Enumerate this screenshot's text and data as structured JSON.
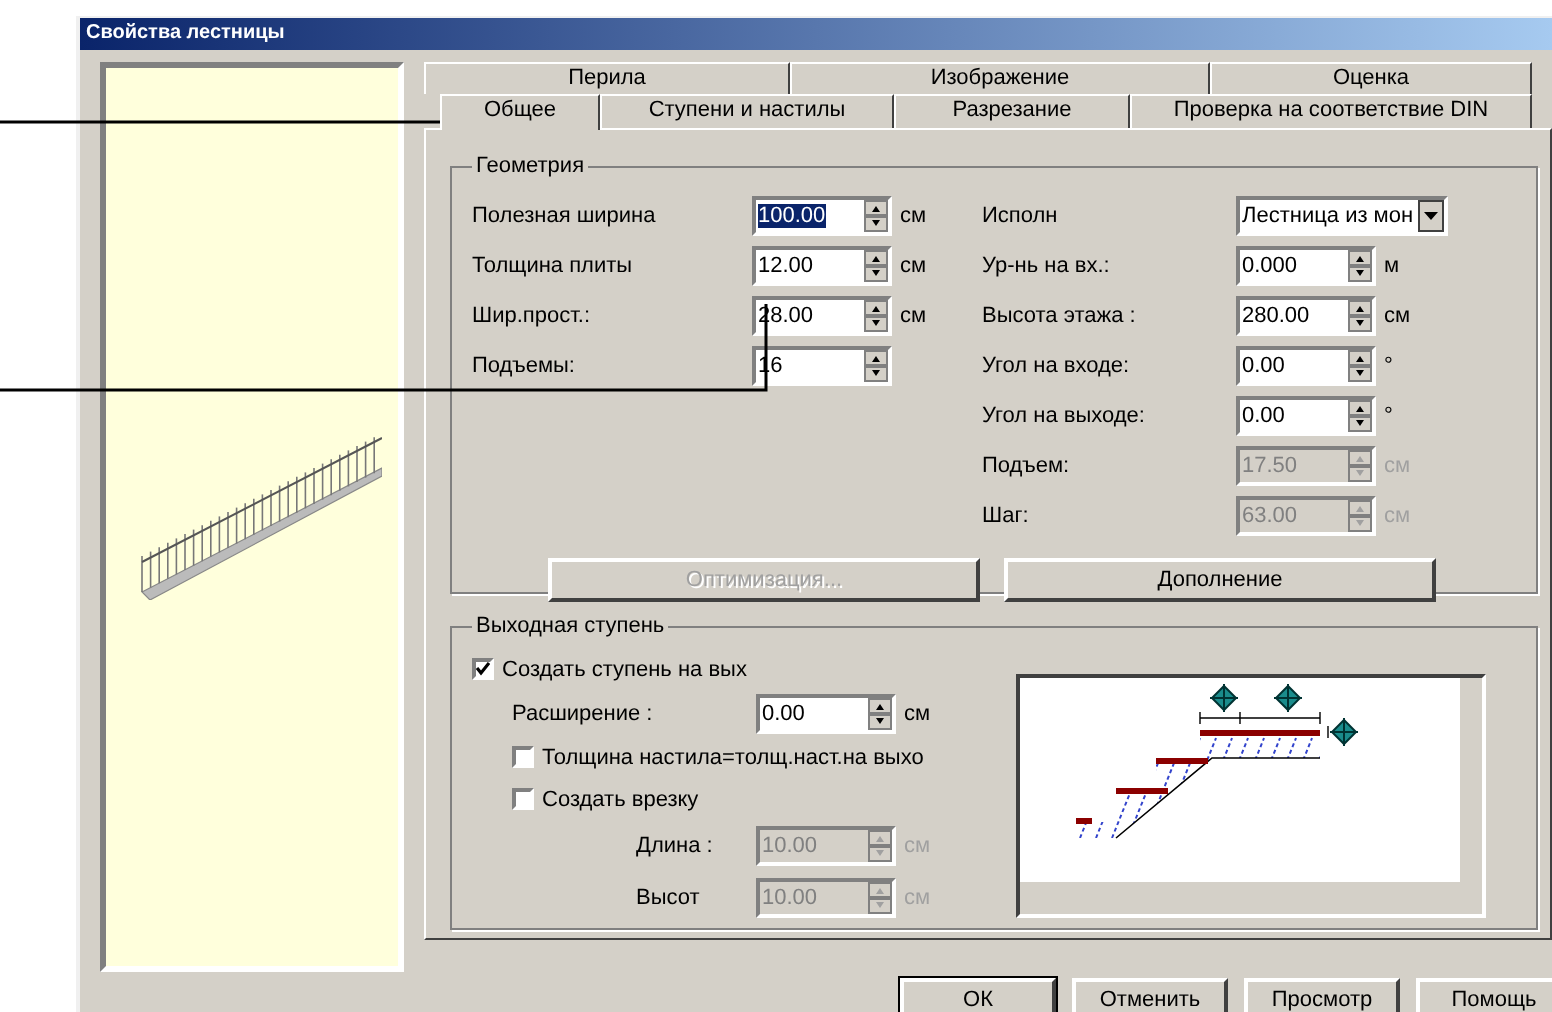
{
  "window": {
    "title": "Свойства лестницы"
  },
  "tabs_row_1": [
    {
      "label": "Перила",
      "selected": false
    },
    {
      "label": "Изображение",
      "selected": false
    },
    {
      "label": "Оценка",
      "selected": false
    }
  ],
  "tabs_row_2": [
    {
      "label": "Общее",
      "selected": true
    },
    {
      "label": "Ступени и настилы",
      "selected": false
    },
    {
      "label": "Разрезание",
      "selected": false
    },
    {
      "label": "Проверка на соответствие DIN",
      "selected": false
    }
  ],
  "geometry": {
    "title": "Геометрия",
    "left_fields": [
      {
        "label": "Полезная ширина",
        "value": "100.00",
        "unit": "см",
        "focused": true
      },
      {
        "label": "Толщина плиты",
        "value": "12.00",
        "unit": "см",
        "focused": false
      },
      {
        "label": "Шир.прост.:",
        "value": "28.00",
        "unit": "см",
        "focused": false
      },
      {
        "label": "Подъемы:",
        "value": "16",
        "focused": false
      }
    ],
    "right_fields": [
      {
        "kind": "select",
        "label": "Исполн",
        "value": "Лестница из мон",
        "disabled": false
      },
      {
        "kind": "spin",
        "label": "Ур-нь на вх.:",
        "value": "0.000",
        "unit": "м",
        "disabled": false
      },
      {
        "kind": "spin",
        "label": "Высота этажа :",
        "value": "280.00",
        "unit": "см",
        "disabled": false
      },
      {
        "kind": "spin",
        "label": "Угол на входе:",
        "value": "0.00",
        "unit": "°",
        "disabled": false
      },
      {
        "kind": "spin",
        "label": "Угол на выходе:",
        "value": "0.00",
        "unit": "°",
        "disabled": false
      },
      {
        "kind": "spin",
        "label": "Подъем:",
        "value": "17.50",
        "unit": "см",
        "disabled": true
      },
      {
        "kind": "spin",
        "label": "Шаг:",
        "value": "63.00",
        "unit": "см",
        "disabled": true
      }
    ],
    "buttons": [
      {
        "label": "Оптимизация...",
        "disabled": true
      },
      {
        "label": "Дополнение",
        "disabled": false
      }
    ]
  },
  "exit_step": {
    "title": "Выходная ступень",
    "create_step": {
      "label": "Создать ступень на вых",
      "checked": true
    },
    "extension": {
      "label": "Расширение :",
      "value": "0.00",
      "unit": "см",
      "disabled": false
    },
    "same_thickness": {
      "label": "Толщина настила=толщ.наст.на выхо",
      "checked": false
    },
    "create_cut": {
      "label": "Создать врезку",
      "checked": false
    },
    "cut_fields": [
      {
        "label": "Длина :",
        "value": "10.00",
        "unit": "см",
        "disabled": true
      },
      {
        "label": "Высот",
        "value": "10.00",
        "unit": "см",
        "disabled": true
      }
    ]
  },
  "buttons": [
    "ОК",
    "Отменить",
    "Просмотр",
    "Помощь"
  ]
}
